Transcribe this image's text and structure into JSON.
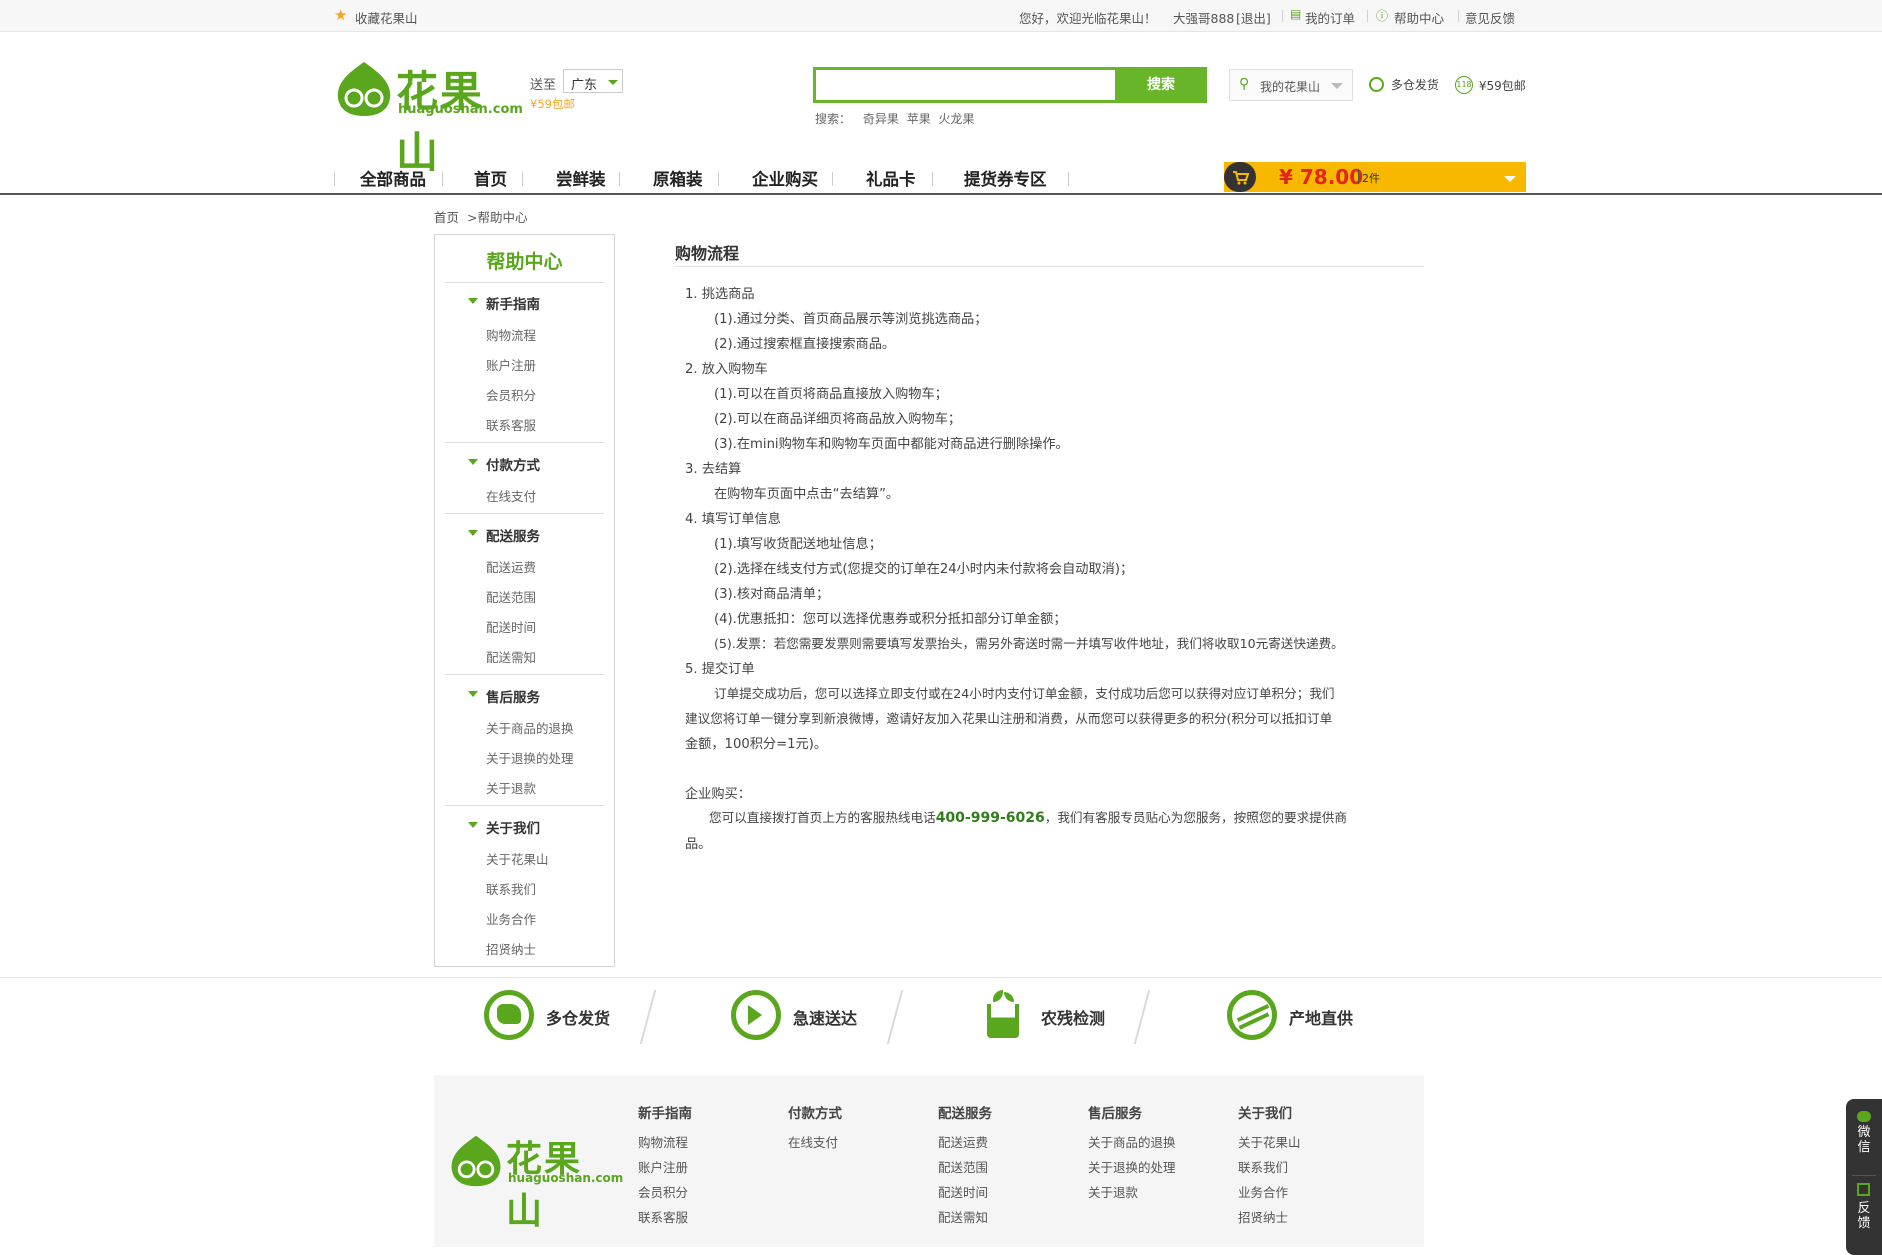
{
  "topbar": {
    "bookmark": "收藏花果山",
    "welcome": "您好，欢迎光临花果山！",
    "user": "大强哥888",
    "logout": "[退出]",
    "my_orders": "我的订单",
    "help_center": "帮助中心",
    "feedback": "意见反馈"
  },
  "header": {
    "logo_cn": "花果山",
    "logo_en": "huaguoshan.com",
    "ship_to": "送至",
    "region": "广东",
    "free_ship": "¥59包邮",
    "search_button": "搜索",
    "search_label": "搜索：",
    "hot_keywords": [
      "奇异果",
      "苹果",
      "火龙果"
    ],
    "my_account": "我的花果山",
    "multi_warehouse": "多仓发货",
    "badge_118": "118",
    "free_ship_59": "¥59包邮"
  },
  "nav": {
    "items": [
      "全部商品",
      "首页",
      "尝鲜装",
      "原箱装",
      "企业购买",
      "礼品卡",
      "提货券专区"
    ]
  },
  "cart": {
    "total": "¥ 78.00",
    "count": "2件"
  },
  "breadcrumb": {
    "home": "首页",
    "current": ">帮助中心"
  },
  "sidebar": {
    "title": "帮助中心",
    "groups": [
      {
        "label": "新手指南",
        "items": [
          "购物流程",
          "账户注册",
          "会员积分",
          "联系客服"
        ]
      },
      {
        "label": "付款方式",
        "items": [
          "在线支付"
        ]
      },
      {
        "label": "配送服务",
        "items": [
          "配送运费",
          "配送范围",
          "配送时间",
          "配送需知"
        ]
      },
      {
        "label": "售后服务",
        "items": [
          "关于商品的退换",
          "关于退换的处理",
          "关于退款"
        ]
      },
      {
        "label": "关于我们",
        "items": [
          "关于花果山",
          "联系我们",
          "业务合作",
          "招贤纳士"
        ]
      }
    ]
  },
  "content": {
    "title": "购物流程",
    "lines": [
      "1. 挑选商品",
      "(1).通过分类、首页商品展示等浏览挑选商品；",
      "(2).通过搜索框直接搜索商品。",
      "2. 放入购物车",
      "(1).可以在首页将商品直接放入购物车；",
      "(2).可以在商品详细页将商品放入购物车；",
      "(3).在mini购物车和购物车页面中都能对商品进行删除操作。",
      "3. 去结算",
      "在购物车页面中点击“去结算”。",
      "4. 填写订单信息",
      "(1).填写收货配送地址信息；",
      "(2).选择在线支付方式(您提交的订单在24小时内未付款将会自动取消)；",
      "(3).核对商品清单；",
      "(4).优惠抵扣：您可以选择优惠券或积分抵扣部分订单金额；",
      "(5).发票：若您需要发票则需要填写发票抬头，需另外寄送时需一并填写收件地址，我们将收取10元寄送快递费。",
      "5. 提交订单",
      "订单提交成功后，您可以选择立即支付或在24小时内支付订单金额，支付成功后您可以获得对应订单积分；我们",
      "建议您将订单一键分享到新浪微博，邀请好友加入花果山注册和消费，从而您可以获得更多的积分(积分可以抵扣订单",
      "金额，100积分=1元)。"
    ],
    "corp_title": "企业购买：",
    "corp_pre": "您可以直接拨打首页上方的客服热线电话",
    "hotline": "400-999-6026",
    "corp_post": "，我们有客服专员贴心为您服务，按照您的要求提供商",
    "corp_end": "品。"
  },
  "features": [
    "多仓发货",
    "急速送达",
    "农残检测",
    "产地直供"
  ],
  "footer": {
    "logo_cn": "花果山",
    "logo_en": "huaguoshan.com",
    "columns": [
      {
        "title": "新手指南",
        "items": [
          "购物流程",
          "账户注册",
          "会员积分",
          "联系客服"
        ]
      },
      {
        "title": "付款方式",
        "items": [
          "在线支付"
        ]
      },
      {
        "title": "配送服务",
        "items": [
          "配送运费",
          "配送范围",
          "配送时间",
          "配送需知"
        ]
      },
      {
        "title": "售后服务",
        "items": [
          "关于商品的退换",
          "关于退换的处理",
          "关于退款"
        ]
      },
      {
        "title": "关于我们",
        "items": [
          "关于花果山",
          "联系我们",
          "业务合作",
          "招贤纳士"
        ]
      }
    ]
  },
  "float": {
    "wechat": "微信",
    "feedback": "反馈"
  },
  "colors": {
    "brand_green": "#5aa71e",
    "cart_yellow": "#f9b800",
    "price_red": "#e4251e"
  }
}
